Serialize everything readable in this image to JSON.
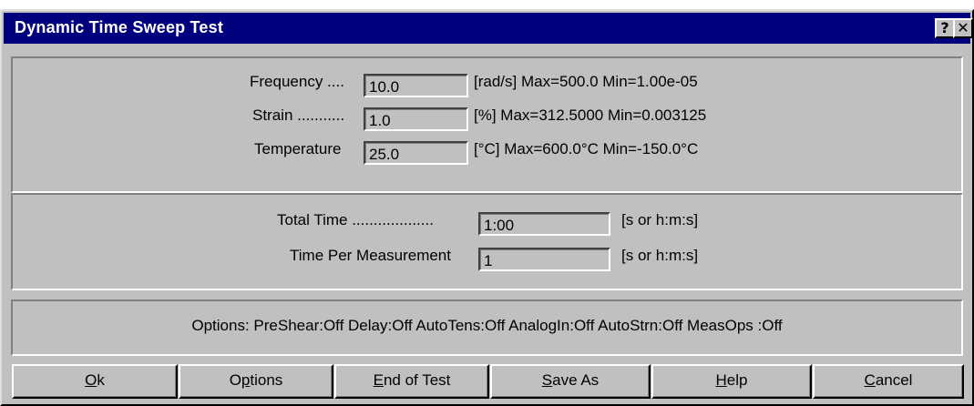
{
  "dialog": {
    "title": "Dynamic Time Sweep Test",
    "help_glyph": "?",
    "close_glyph": "✕"
  },
  "params": {
    "frequency": {
      "label": "Frequency ....",
      "value": "10.0",
      "range": "[rad/s] Max=500.0  Min=1.00e-05"
    },
    "strain": {
      "label": "Strain ...........",
      "value": "1.0",
      "range": "[%] Max=312.5000  Min=0.003125"
    },
    "temperature": {
      "label": "Temperature",
      "value": "25.0",
      "range": "[°C] Max=600.0°C  Min=-150.0°C"
    }
  },
  "time": {
    "total_time": {
      "label": "Total Time ...................",
      "value": "1:00",
      "unit": "[s or h:m:s]"
    },
    "time_per_measurement": {
      "label": "Time Per Measurement",
      "value": "1",
      "unit": "[s or h:m:s]"
    }
  },
  "options_line": "Options:  PreShear:Off  Delay:Off  AutoTens:Off  AnalogIn:Off  AutoStrn:Off  MeasOps :Off",
  "buttons": {
    "ok": {
      "mnemonic": "O",
      "rest": "k"
    },
    "options": {
      "before": "O",
      "mnemonic": "p",
      "rest": "tions"
    },
    "end_of_test": {
      "mnemonic": "E",
      "rest": "nd of Test"
    },
    "save_as": {
      "mnemonic": "S",
      "rest": "ave As"
    },
    "help": {
      "mnemonic": "H",
      "rest": "elp"
    },
    "cancel": {
      "mnemonic": "C",
      "rest": "ancel"
    }
  }
}
